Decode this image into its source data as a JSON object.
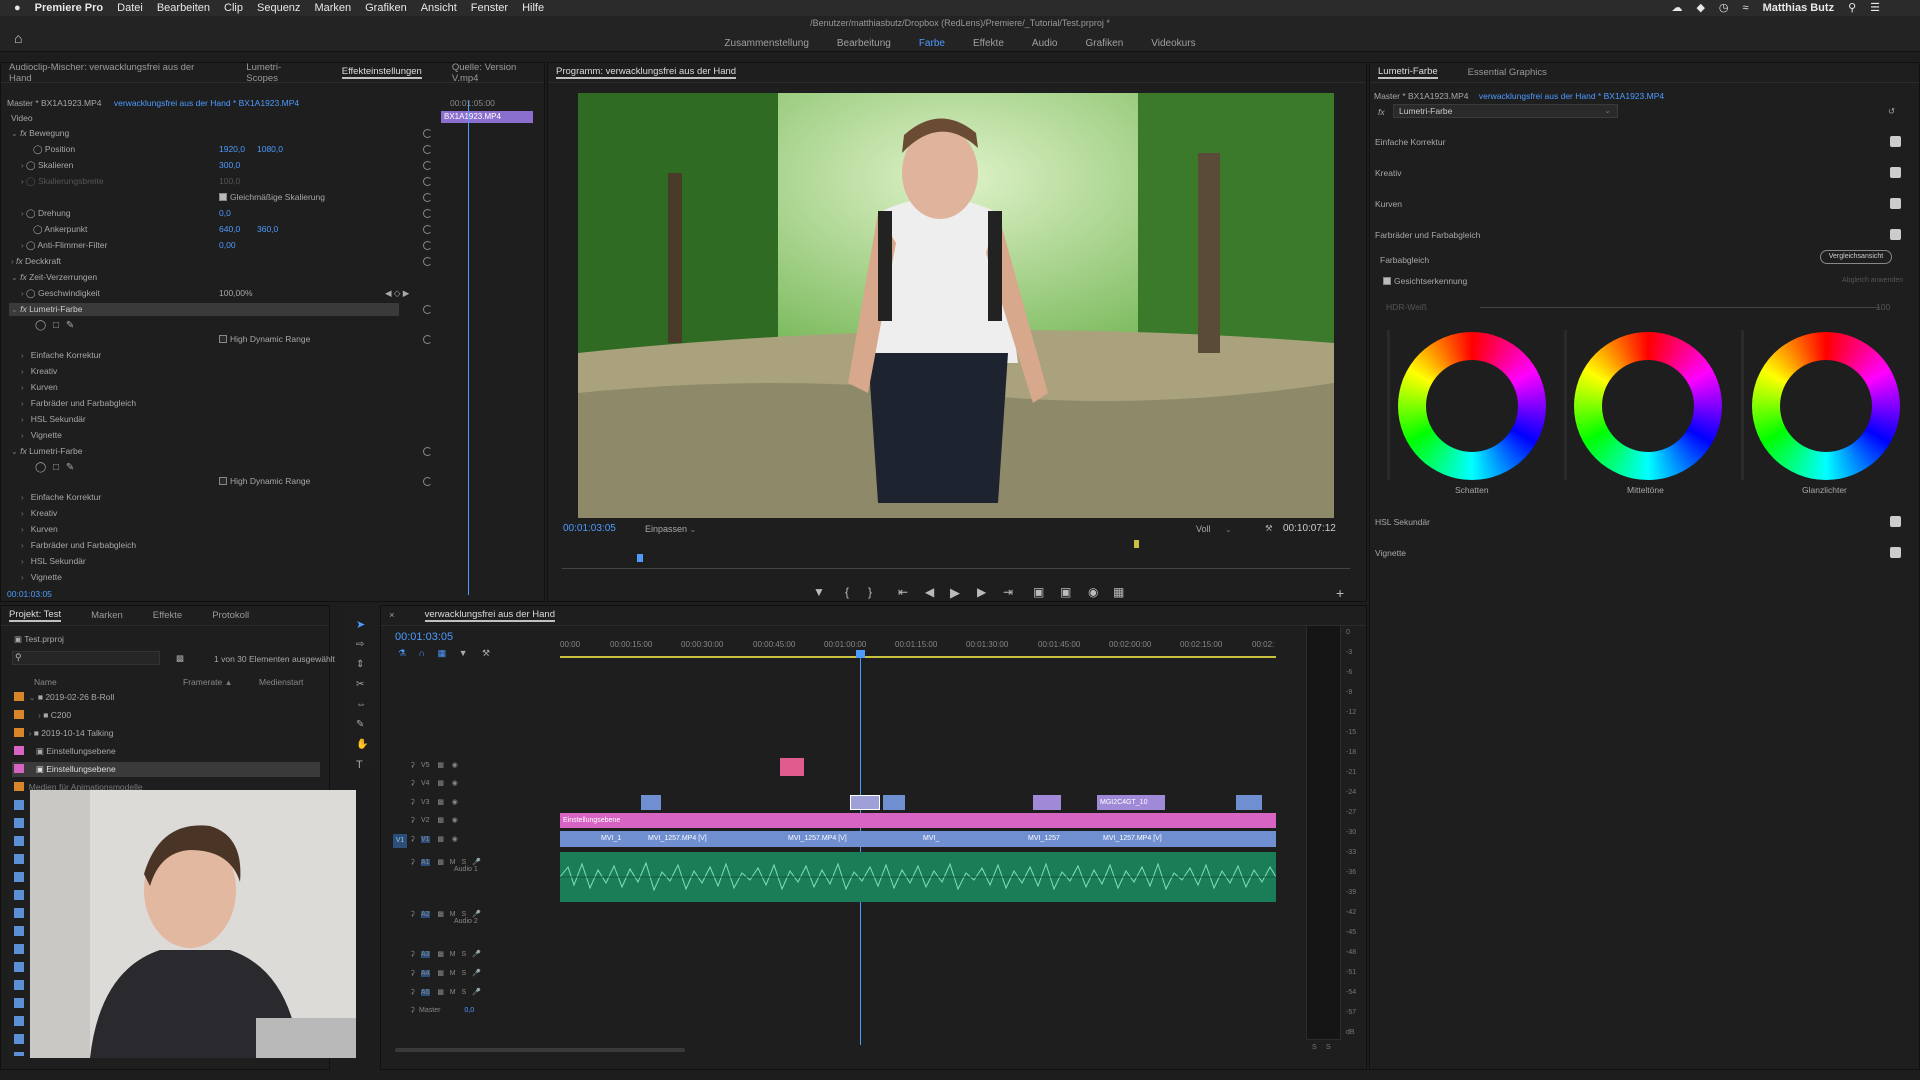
{
  "menubar": {
    "app": "Premiere Pro",
    "items": [
      "Datei",
      "Bearbeiten",
      "Clip",
      "Sequenz",
      "Marken",
      "Grafiken",
      "Ansicht",
      "Fenster",
      "Hilfe"
    ],
    "user": "Matthias Butz"
  },
  "workspace": {
    "path": "/Benutzer/matthiasbutz/Dropbox (RedLens)/Premiere/_Tutorial/Test.prproj *",
    "tabs": [
      "Zusammenstellung",
      "Bearbeitung",
      "Farbe",
      "Effekte",
      "Audio",
      "Grafiken",
      "Videokurs"
    ],
    "active_tab": "Farbe"
  },
  "effects_panel": {
    "tabs": [
      "Audioclip-Mischer: verwacklungsfrei aus der Hand",
      "Lumetri-Scopes",
      "Effekteinstellungen",
      "Quelle: Version V.mp4"
    ],
    "master_label": "Master * BX1A1923.MP4",
    "sequence_label": "verwacklungsfrei aus der Hand * BX1A1923.MP4",
    "timecode_head": "00:01:05:00",
    "clip_name": "BX1A1923.MP4",
    "video_label": "Video",
    "bewegung": "Bewegung",
    "position_label": "Position",
    "position_x": "1920,0",
    "position_y": "1080,0",
    "skalieren_label": "Skalieren",
    "skalieren_val": "300,0",
    "skalierungsbreite_label": "Skalierungsbreite",
    "skalierungsbreite_val": "100,0",
    "gleichmaessig_label": "Gleichmäßige Skalierung",
    "drehung_label": "Drehung",
    "drehung_val": "0,0",
    "ankerpunkt_label": "Ankerpunkt",
    "anker_x": "640,0",
    "anker_y": "360,0",
    "antiflimmer_label": "Anti-Flimmer-Filter",
    "antiflimmer_val": "0,00",
    "deckkraft": "Deckkraft",
    "zeitverzerrung": "Zeit-Verzerrungen",
    "geschwindigkeit_label": "Geschwindigkeit",
    "geschwindigkeit_val": "100,00%",
    "lumetri1": "Lumetri-Farbe",
    "hdr_label": "High Dynamic Range",
    "lumetri_items": [
      "Einfache Korrektur",
      "Kreativ",
      "Kurven",
      "Farbräder und Farbabgleich",
      "HSL Sekundär",
      "Vignette"
    ],
    "lumetri2": "Lumetri-Farbe",
    "footer_timecode": "00:01:03:05"
  },
  "program": {
    "title": "Programm: verwacklungsfrei aus der Hand",
    "timecode_left": "00:01:03:05",
    "fit": "Einpassen",
    "quality": "Voll",
    "timecode_right": "00:10:07:12"
  },
  "lumetri_panel": {
    "tabs": [
      "Lumetri-Farbe",
      "Essential Graphics"
    ],
    "master_label": "Master * BX1A1923.MP4",
    "sequence_label": "verwacklungsfrei aus der Hand * BX1A1923.MP4",
    "fx_select": "Lumetri-Farbe",
    "sections": [
      "Einfache Korrektur",
      "Kreativ",
      "Kurven",
      "Farbräder und Farbabgleich"
    ],
    "farbabgleich": "Farbabgleich",
    "vergleich_button": "Vergleichsansicht",
    "gesicht_label": "Gesichtserkennung",
    "abgleich_anwenden": "Abgleich anwenden",
    "hdr_weiss": "HDR-Weiß",
    "hdr_val": "100",
    "wheels": [
      "Schatten",
      "Mitteltöne",
      "Glanzlichter"
    ],
    "bottom_sections": [
      "HSL Sekundär",
      "Vignette"
    ]
  },
  "project_panel": {
    "tabs": [
      "Projekt: Test",
      "Marken",
      "Effekte",
      "Protokoll"
    ],
    "file": "Test.prproj",
    "selection": "1 von 30 Elementen ausgewählt",
    "columns": [
      "Name",
      "Framerate",
      "Medienstart"
    ],
    "items": [
      "2019-02-26 B-Roll",
      "C200",
      "2019-10-14 Talking",
      "Einstellungsebene",
      "Einstellungsebene",
      "Medien für Animationsmodelle"
    ]
  },
  "timeline": {
    "title": "verwacklungsfrei aus der Hand",
    "timecode": "00:01:03:05",
    "ruler": [
      "00:00",
      "00:00:15:00",
      "00:00:30:00",
      "00:00:45:00",
      "00:01:00:00",
      "00:01:15:00",
      "00:01:30:00",
      "00:01:45:00",
      "00:02:00:00",
      "00:02:15:00",
      "00:02:"
    ],
    "tracks": [
      "V5",
      "V4",
      "V3",
      "V2",
      "V1",
      "A1",
      "A2",
      "A3",
      "A4",
      "A5"
    ],
    "audio1": "Audio 1",
    "audio2": "Audio 2",
    "master": "Master",
    "master_val": "0,0",
    "adjustment_clip": "Einstellungsebene",
    "v1_clips": [
      "MVI_1",
      "MVI_1257.MP4 [V]",
      "MVI_1257.MP4 [V]",
      "MVI_",
      "MVI_1257",
      "MVI_1257.MP4 [V]"
    ],
    "v3_clip": "MGI2C4GT_10",
    "meter_labels": [
      "0",
      "-3",
      "-6",
      "-9",
      "-12",
      "-15",
      "-18",
      "-21",
      "-24",
      "-27",
      "-30",
      "-33",
      "-36",
      "-39",
      "-42",
      "-45",
      "-48",
      "-51",
      "-54",
      "-57",
      "dB"
    ],
    "meter_bottom": [
      "S",
      "S"
    ]
  }
}
